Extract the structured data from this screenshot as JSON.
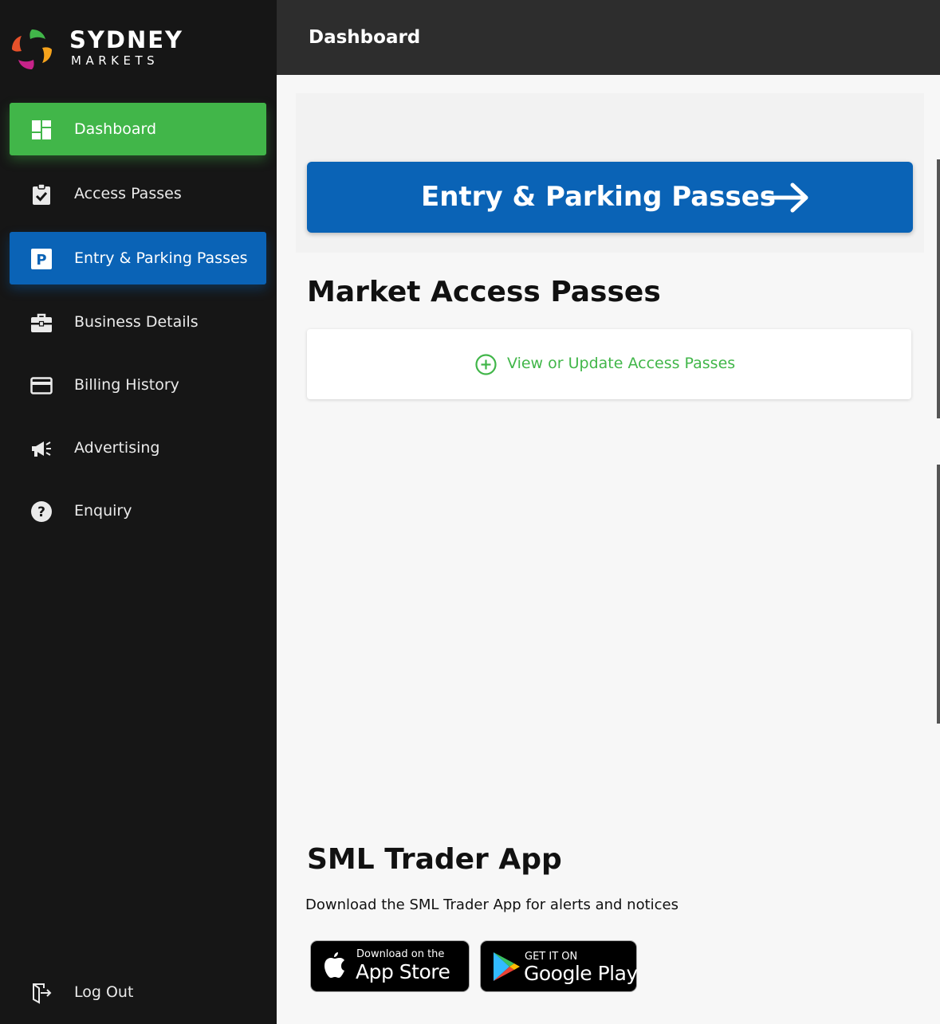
{
  "brand": {
    "name_line1": "SYDNEY",
    "name_line2": "MARKETS",
    "logo_colors": [
      "#e8512a",
      "#41b649",
      "#f6a31c",
      "#c7238a"
    ]
  },
  "sidebar": {
    "items": [
      {
        "label": "Dashboard",
        "icon": "dashboard-icon",
        "state": "active"
      },
      {
        "label": "Access Passes",
        "icon": "clipboard-check-icon"
      },
      {
        "label": "Entry & Parking Passes",
        "icon": "parking-icon",
        "state": "highlighted"
      },
      {
        "label": "Business Details",
        "icon": "briefcase-icon"
      },
      {
        "label": "Billing History",
        "icon": "credit-card-icon"
      },
      {
        "label": "Advertising",
        "icon": "megaphone-icon"
      },
      {
        "label": "Enquiry",
        "icon": "help-circle-icon"
      }
    ],
    "logout_label": "Log Out"
  },
  "header": {
    "title": "Dashboard"
  },
  "main": {
    "entry_button_label": "Entry & Parking Passes",
    "market_access": {
      "title": "Market Access Passes",
      "action_label": "View or Update Access Passes"
    },
    "trader_app": {
      "title": "SML Trader App",
      "description": "Download the SML Trader App for alerts and notices",
      "app_store": {
        "small": "Download on the",
        "big": "App Store"
      },
      "google_play": {
        "small": "GET IT ON",
        "big": "Google Play"
      }
    }
  },
  "colors": {
    "sidebar_bg": "#161616",
    "header_bg": "#2d2d2d",
    "green_accent": "#41b649",
    "blue_accent": "#0a63b6"
  }
}
